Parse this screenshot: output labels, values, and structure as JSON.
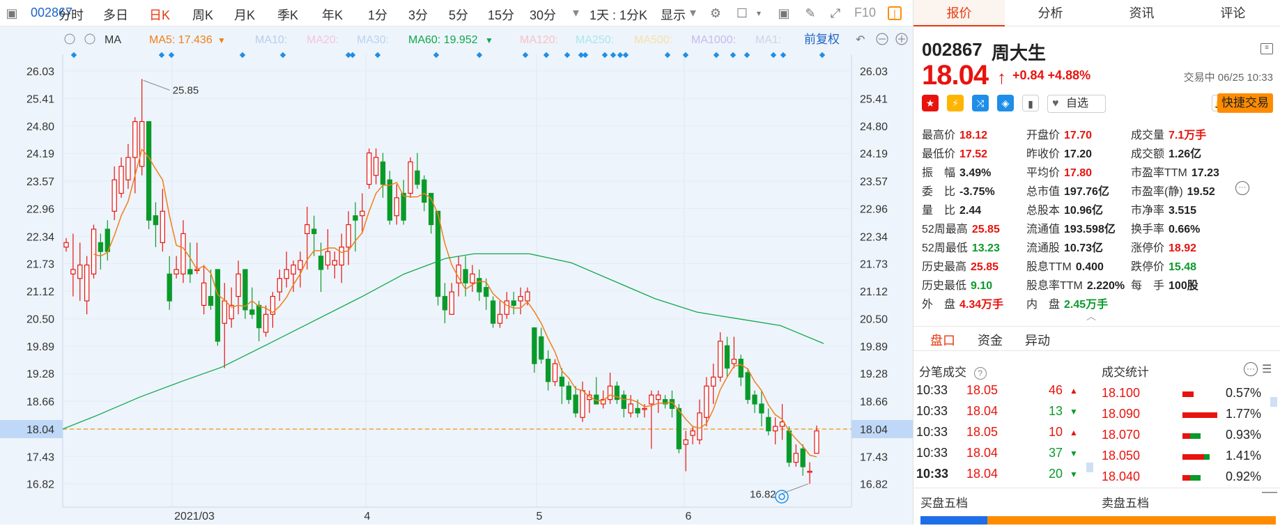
{
  "toolbar": {
    "code": "002867",
    "periods": [
      "分时",
      "多日",
      "日K",
      "周K",
      "月K",
      "季K",
      "年K",
      "1分",
      "3分",
      "5分",
      "15分",
      "30分"
    ],
    "active_period": "日K",
    "dropdown_more": "▾",
    "interval": "1天 : 1分K",
    "display": "显示",
    "f10": "F10"
  },
  "ma_bar": {
    "ma_label": "MA",
    "ma5": "MA5: 17.436",
    "ma10": "MA10:",
    "ma20": "MA20:",
    "ma30": "MA30:",
    "ma60": "MA60: 19.952",
    "ma120": "MA120:",
    "ma250": "MA250:",
    "ma500": "MA500:",
    "ma1000": "MA1000:",
    "ma1": "MA1:",
    "adjust": "前复权",
    "colors": {
      "ma5": "#f07f17",
      "ma10": "#b6ccf0",
      "ma20": "#f3c4e6",
      "ma30": "#b7d4f0",
      "ma60": "#0fa84c",
      "ma120": "#f6c3c3",
      "ma250": "#a8e6f0",
      "ma500": "#f6e0a8",
      "ma1000": "#c8b8f0",
      "ma1": "#c8d6ea"
    }
  },
  "chart_data": {
    "type": "candlestick",
    "y_ticks": [
      "26.03",
      "25.41",
      "24.80",
      "24.19",
      "23.57",
      "22.96",
      "22.34",
      "21.73",
      "21.12",
      "20.50",
      "19.89",
      "19.28",
      "18.66",
      "18.04",
      "17.43",
      "16.82"
    ],
    "ylim": [
      16.3,
      26.4
    ],
    "x_labels": [
      "2021/03",
      "4",
      "5",
      "6"
    ],
    "current_price": "18.04",
    "max_label": "25.85",
    "min_label": "16.82",
    "candles": [
      [
        22.1,
        22.2,
        22.3,
        22.0
      ],
      [
        21.5,
        21.6,
        22.4,
        21.0
      ],
      [
        21.4,
        21.7,
        22.2,
        20.9
      ],
      [
        20.9,
        21.7,
        21.9,
        20.6
      ],
      [
        21.5,
        22.5,
        22.6,
        21.4
      ],
      [
        22.2,
        22.0,
        22.4,
        21.6
      ],
      [
        22.5,
        22.0,
        22.7,
        21.8
      ],
      [
        22.9,
        23.6,
        23.9,
        22.7
      ],
      [
        23.3,
        23.9,
        24.1,
        23.2
      ],
      [
        23.6,
        24.1,
        24.4,
        23.4
      ],
      [
        24.1,
        24.9,
        25.0,
        23.3
      ],
      [
        23.9,
        24.9,
        25.85,
        23.7
      ],
      [
        24.9,
        22.7,
        24.9,
        22.5
      ],
      [
        22.8,
        22.6,
        23.1,
        22.1
      ],
      [
        22.2,
        22.9,
        23.4,
        22.0
      ],
      [
        21.5,
        20.9,
        21.9,
        20.7
      ],
      [
        21.5,
        21.6,
        21.9,
        21.4
      ],
      [
        21.5,
        22.4,
        22.7,
        21.3
      ],
      [
        21.6,
        21.5,
        22.2,
        21.3
      ],
      [
        21.6,
        21.6,
        22.2,
        21.5
      ],
      [
        20.8,
        21.3,
        21.7,
        20.6
      ],
      [
        21.0,
        20.8,
        21.6,
        20.7
      ],
      [
        21.6,
        20.0,
        21.6,
        19.9
      ],
      [
        20.4,
        20.9,
        21.3,
        19.4
      ],
      [
        20.5,
        20.8,
        21.2,
        20.3
      ],
      [
        21.0,
        21.5,
        21.8,
        20.6
      ],
      [
        21.6,
        20.7,
        21.6,
        20.5
      ],
      [
        20.7,
        20.6,
        21.2,
        20.5
      ],
      [
        20.8,
        20.3,
        20.9,
        20.0
      ],
      [
        20.2,
        20.6,
        20.8,
        20.1
      ],
      [
        20.6,
        21.0,
        21.1,
        20.3
      ],
      [
        21.1,
        21.4,
        21.6,
        20.9
      ],
      [
        21.4,
        21.6,
        22.0,
        21.2
      ],
      [
        21.5,
        21.7,
        21.8,
        21.1
      ],
      [
        21.6,
        21.8,
        22.0,
        21.2
      ],
      [
        22.4,
        22.6,
        23.0,
        21.6
      ],
      [
        22.5,
        22.4,
        22.8,
        21.9
      ],
      [
        21.9,
        21.6,
        22.2,
        21.1
      ],
      [
        21.7,
        22.0,
        22.5,
        21.6
      ],
      [
        21.7,
        21.8,
        22.0,
        21.4
      ],
      [
        21.7,
        22.1,
        22.4,
        21.3
      ],
      [
        22.1,
        22.6,
        22.9,
        21.7
      ],
      [
        22.8,
        22.7,
        23.1,
        22.0
      ],
      [
        22.8,
        22.9,
        23.3,
        22.4
      ],
      [
        23.5,
        24.2,
        24.3,
        23.4
      ],
      [
        23.7,
        24.1,
        24.3,
        23.5
      ],
      [
        24.0,
        23.5,
        24.2,
        23.2
      ],
      [
        23.6,
        22.7,
        23.8,
        22.6
      ],
      [
        22.8,
        23.2,
        23.5,
        22.6
      ],
      [
        23.3,
        22.7,
        23.6,
        22.6
      ],
      [
        23.3,
        24.0,
        24.1,
        23.2
      ],
      [
        23.8,
        23.5,
        24.2,
        23.4
      ],
      [
        23.6,
        23.1,
        23.7,
        22.9
      ],
      [
        23.3,
        22.6,
        23.3,
        22.4
      ],
      [
        22.9,
        21.0,
        22.9,
        20.8
      ],
      [
        21.0,
        20.7,
        21.3,
        20.4
      ],
      [
        20.6,
        21.1,
        21.3,
        20.6
      ],
      [
        21.3,
        21.7,
        21.9,
        21.0
      ],
      [
        21.6,
        21.3,
        21.9,
        21.0
      ],
      [
        21.3,
        21.5,
        21.7,
        21.1
      ],
      [
        21.4,
        21.1,
        21.6,
        20.9
      ],
      [
        21.2,
        21.0,
        21.4,
        20.7
      ],
      [
        20.9,
        20.4,
        21.0,
        20.3
      ],
      [
        20.4,
        20.6,
        20.9,
        20.3
      ],
      [
        20.6,
        20.9,
        21.1,
        20.5
      ],
      [
        20.9,
        20.8,
        21.1,
        20.6
      ],
      [
        20.9,
        21.0,
        21.2,
        20.6
      ],
      [
        20.9,
        21.1,
        21.2,
        20.8
      ],
      [
        20.3,
        19.5,
        20.3,
        19.3
      ],
      [
        20.1,
        19.6,
        20.3,
        19.5
      ],
      [
        19.6,
        19.1,
        19.8,
        18.9
      ],
      [
        19.1,
        19.5,
        19.6,
        19.0
      ],
      [
        19.2,
        19.0,
        19.4,
        18.6
      ],
      [
        19.0,
        18.7,
        19.1,
        18.6
      ],
      [
        18.8,
        18.4,
        19.0,
        18.3
      ],
      [
        18.3,
        18.9,
        19.1,
        18.2
      ],
      [
        18.7,
        18.8,
        18.9,
        18.4
      ],
      [
        18.8,
        18.6,
        19.2,
        18.6
      ],
      [
        18.6,
        18.7,
        18.9,
        18.5
      ],
      [
        18.7,
        19.0,
        19.3,
        18.6
      ],
      [
        19.0,
        18.7,
        19.1,
        18.6
      ],
      [
        18.8,
        18.5,
        18.9,
        18.3
      ],
      [
        18.4,
        18.6,
        18.8,
        18.3
      ],
      [
        18.5,
        18.4,
        18.7,
        18.3
      ],
      [
        18.5,
        18.5,
        18.6,
        18.3
      ],
      [
        18.6,
        18.8,
        18.9,
        17.6
      ],
      [
        18.7,
        18.8,
        18.9,
        18.4
      ],
      [
        18.7,
        18.6,
        18.8,
        18.5
      ],
      [
        18.7,
        18.5,
        18.9,
        18.3
      ],
      [
        18.5,
        17.6,
        18.6,
        17.5
      ],
      [
        17.7,
        17.8,
        18.0,
        17.1
      ],
      [
        17.9,
        18.0,
        18.1,
        17.7
      ],
      [
        17.8,
        18.4,
        18.7,
        17.7
      ],
      [
        18.3,
        19.0,
        19.2,
        18.1
      ],
      [
        19.0,
        19.2,
        19.5,
        18.6
      ],
      [
        19.2,
        20.0,
        20.2,
        19.1
      ],
      [
        19.9,
        19.4,
        20.1,
        19.2
      ],
      [
        19.5,
        19.6,
        20.1,
        19.4
      ],
      [
        19.6,
        19.2,
        19.7,
        19.0
      ],
      [
        19.3,
        18.7,
        19.4,
        18.6
      ],
      [
        18.8,
        18.6,
        18.9,
        18.4
      ],
      [
        18.6,
        18.4,
        18.9,
        18.1
      ],
      [
        18.3,
        18.0,
        18.5,
        17.9
      ],
      [
        18.0,
        18.1,
        18.3,
        17.7
      ],
      [
        18.1,
        18.2,
        18.6,
        17.8
      ],
      [
        18.0,
        17.3,
        18.1,
        17.2
      ],
      [
        17.3,
        17.5,
        17.7,
        17.2
      ],
      [
        17.6,
        17.2,
        17.7,
        17.0
      ],
      [
        17.1,
        17.1,
        17.3,
        16.82
      ],
      [
        17.5,
        18.0,
        18.12,
        17.52
      ]
    ]
  },
  "quote": {
    "code": "002867",
    "name": "周大生",
    "price": "18.04",
    "arrow": "↑",
    "change": "+0.84 +4.88%",
    "status": "交易中 06/25 10:33",
    "fav": "自选",
    "quick_trade": "快捷交易",
    "fields": [
      [
        {
          "k": "最高价",
          "v": "18.12",
          "c": "red"
        },
        {
          "k": "开盘价",
          "v": "17.70",
          "c": "red"
        },
        {
          "k": "成交量",
          "v": "7.1万手",
          "c": "red"
        }
      ],
      [
        {
          "k": "最低价",
          "v": "17.52",
          "c": "red"
        },
        {
          "k": "昨收价",
          "v": "17.20",
          "c": "blk"
        },
        {
          "k": "成交额",
          "v": "1.26亿",
          "c": "blk"
        }
      ],
      [
        {
          "k": "振　幅",
          "v": "3.49%",
          "c": "blk"
        },
        {
          "k": "平均价",
          "v": "17.80",
          "c": "red"
        },
        {
          "k": "市盈率TTM",
          "v": "17.23",
          "c": "blk"
        }
      ],
      [
        {
          "k": "委　比",
          "v": "-3.75%",
          "c": "blk"
        },
        {
          "k": "总市值",
          "v": "197.76亿",
          "c": "blk"
        },
        {
          "k": "市盈率(静)",
          "v": "19.52",
          "c": "blk"
        }
      ],
      [
        {
          "k": "量　比",
          "v": "2.44",
          "c": "blk"
        },
        {
          "k": "总股本",
          "v": "10.96亿",
          "c": "blk"
        },
        {
          "k": "市净率",
          "v": "3.515",
          "c": "blk"
        }
      ],
      [
        {
          "k": "52周最高",
          "v": "25.85",
          "c": "red"
        },
        {
          "k": "流通值",
          "v": "193.598亿",
          "c": "blk"
        },
        {
          "k": "换手率",
          "v": "0.66%",
          "c": "blk"
        }
      ],
      [
        {
          "k": "52周最低",
          "v": "13.23",
          "c": "green"
        },
        {
          "k": "流通股",
          "v": "10.73亿",
          "c": "blk"
        },
        {
          "k": "涨停价",
          "v": "18.92",
          "c": "red"
        }
      ],
      [
        {
          "k": "历史最高",
          "v": "25.85",
          "c": "red"
        },
        {
          "k": "股息TTM",
          "v": "0.400",
          "c": "blk"
        },
        {
          "k": "跌停价",
          "v": "15.48",
          "c": "green"
        }
      ],
      [
        {
          "k": "历史最低",
          "v": "9.10",
          "c": "green"
        },
        {
          "k": "股息率TTM",
          "v": "2.220%",
          "c": "blk"
        },
        {
          "k": "每　手",
          "v": "100股",
          "c": "blk"
        }
      ],
      [
        {
          "k": "外　盘",
          "v": "4.34万手",
          "c": "red"
        },
        {
          "k": "内　盘",
          "v": "2.45万手",
          "c": "green"
        }
      ]
    ]
  },
  "tabs": [
    "报价",
    "分析",
    "资讯",
    "评论"
  ],
  "sub_tabs": [
    "盘口",
    "资金",
    "异动"
  ],
  "ticks": {
    "title": "分笔成交",
    "rows": [
      {
        "t": "10:33",
        "p": "18.05",
        "v": "46",
        "d": "up"
      },
      {
        "t": "10:33",
        "p": "18.04",
        "v": "13",
        "d": "down"
      },
      {
        "t": "10:33",
        "p": "18.05",
        "v": "10",
        "d": "up"
      },
      {
        "t": "10:33",
        "p": "18.04",
        "v": "37",
        "d": "down"
      },
      {
        "t": "10:33",
        "p": "18.04",
        "v": "20",
        "d": "down"
      }
    ]
  },
  "stats": {
    "title": "成交统计",
    "rows": [
      {
        "p": "18.100",
        "pct": "0.57%",
        "r": 0.57,
        "g": 0.0
      },
      {
        "p": "18.090",
        "pct": "1.77%",
        "r": 1.77,
        "g": 0.0
      },
      {
        "p": "18.070",
        "pct": "0.93%",
        "r": 0.4,
        "g": 0.53
      },
      {
        "p": "18.050",
        "pct": "1.41%",
        "r": 1.1,
        "g": 0.31
      },
      {
        "p": "18.040",
        "pct": "0.92%",
        "r": 0.4,
        "g": 0.52
      }
    ]
  },
  "bottom": {
    "buy5": "买盘五档",
    "sell5": "卖盘五档"
  }
}
